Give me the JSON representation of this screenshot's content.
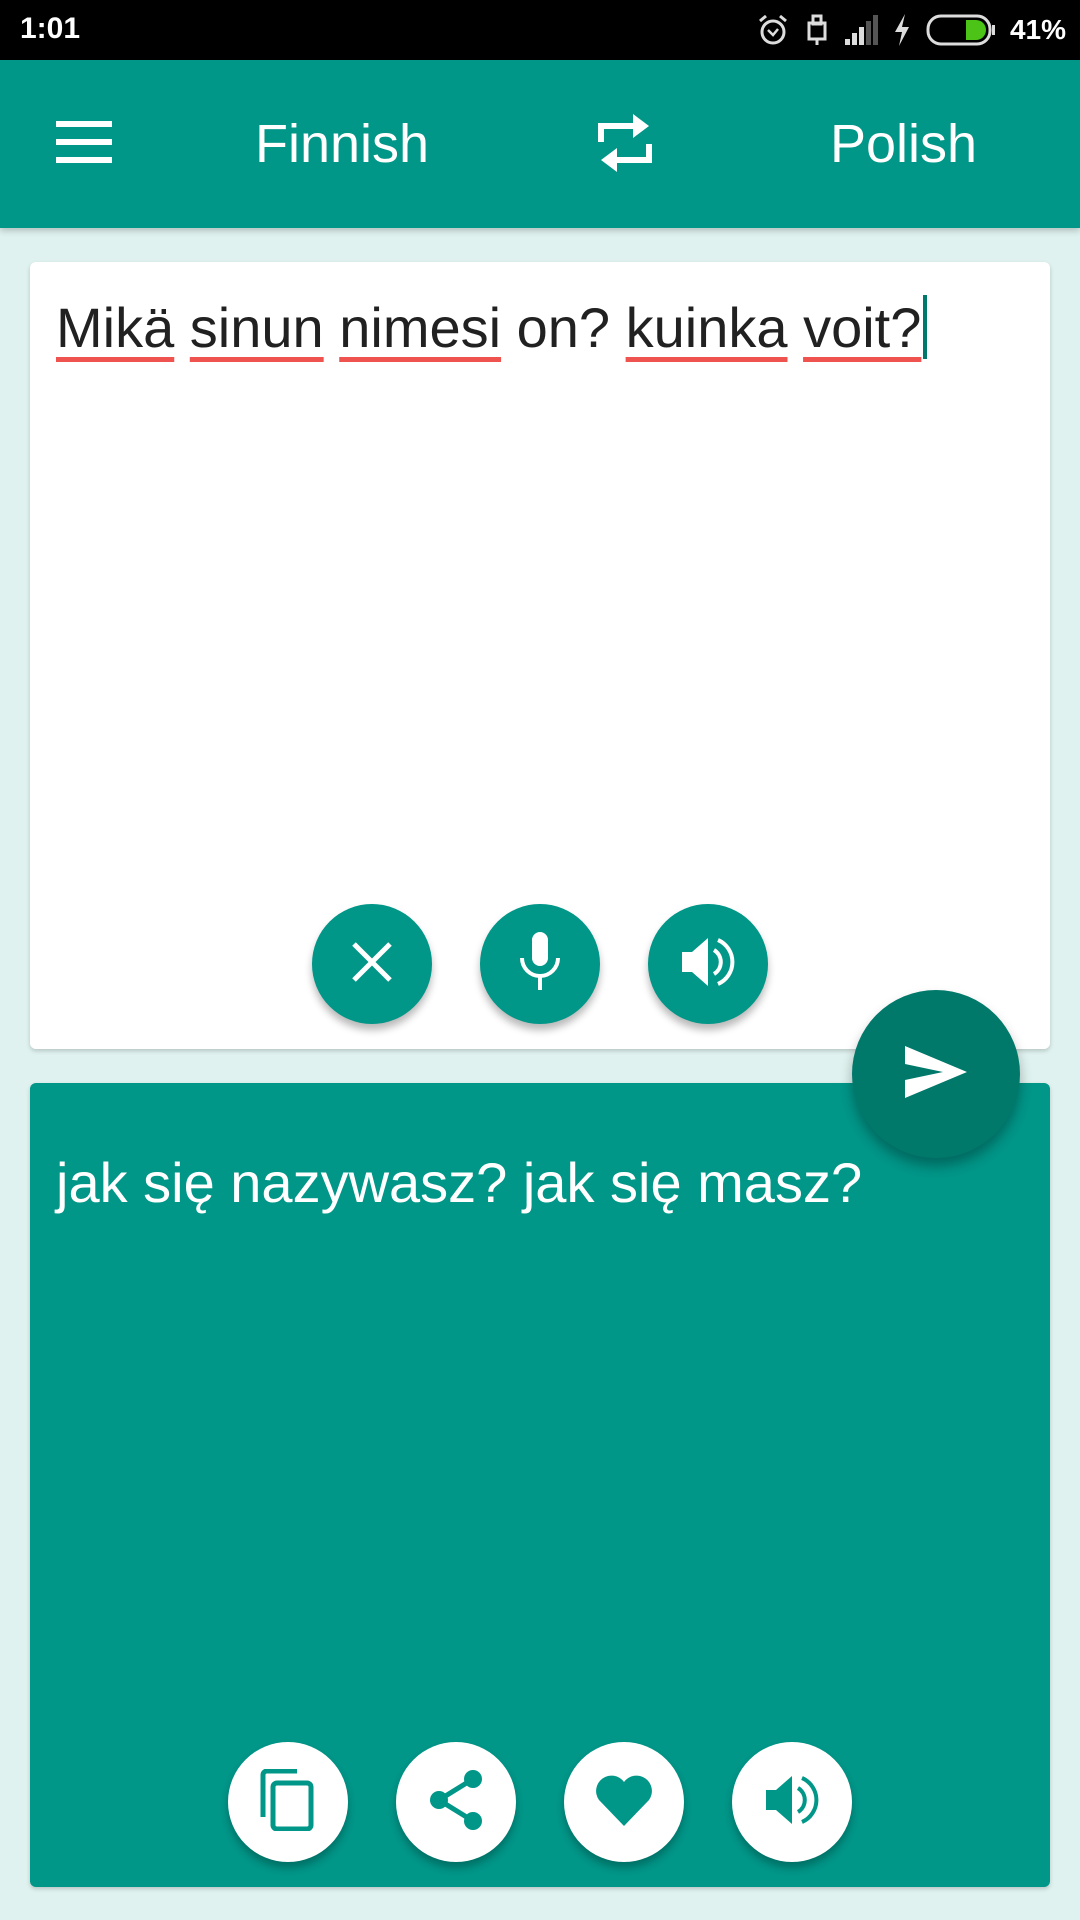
{
  "status_bar": {
    "time": "1:01",
    "icons": [
      "alarm-icon",
      "usb-lock-icon",
      "signal-icon",
      "charging-icon",
      "battery-icon"
    ],
    "battery_percent": "41%",
    "battery_level": 0.41,
    "battery_color": "#4cc417"
  },
  "app_bar": {
    "menu_icon": "hamburger-menu-icon",
    "source_language": "Finnish",
    "swap_icon": "swap-languages-icon",
    "target_language": "Polish",
    "color": "#009688"
  },
  "source": {
    "words": [
      {
        "text": "Mikä",
        "misspelled": true
      },
      {
        "text": "sinun",
        "misspelled": true
      },
      {
        "text": "nimesi",
        "misspelled": true
      },
      {
        "text": "on?",
        "misspelled": false
      },
      {
        "text": "kuinka",
        "misspelled": true
      },
      {
        "text": "voit?",
        "misspelled": true
      }
    ],
    "actions": [
      {
        "name": "clear-button",
        "icon": "close-icon"
      },
      {
        "name": "microphone-button",
        "icon": "microphone-icon"
      },
      {
        "name": "speak-source-button",
        "icon": "speaker-icon"
      }
    ]
  },
  "translate_button": {
    "icon": "send-icon",
    "color": "#00796b"
  },
  "target": {
    "text": "jak się nazywasz? jak się masz?",
    "actions": [
      {
        "name": "copy-button",
        "icon": "copy-icon"
      },
      {
        "name": "share-button",
        "icon": "share-icon"
      },
      {
        "name": "favorite-button",
        "icon": "heart-icon"
      },
      {
        "name": "speak-target-button",
        "icon": "speaker-icon"
      }
    ]
  },
  "colors": {
    "primary": "#009688",
    "primary_dark": "#00796b",
    "background": "#dff2ef",
    "spellcheck_underline": "#ef5350"
  }
}
